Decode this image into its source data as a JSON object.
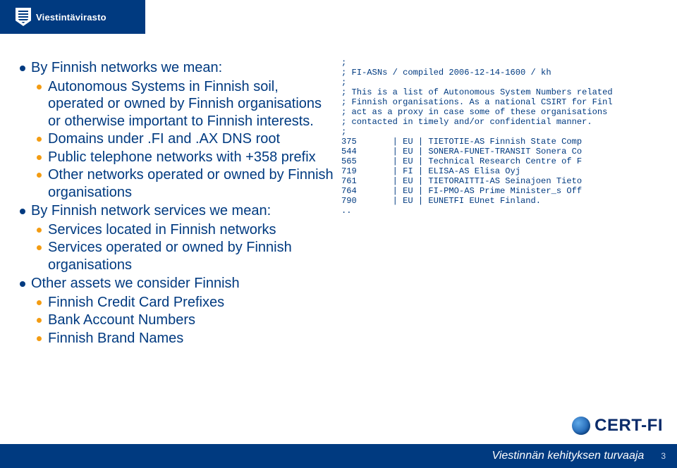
{
  "header": {
    "brand": "Viestintävirasto"
  },
  "left": {
    "l1": "By Finnish networks we mean:",
    "l1a": "Autonomous Systems in Finnish soil, operated or owned by Finnish organisations or otherwise important to Finnish interests.",
    "l1b": "Domains under .FI and .AX DNS root",
    "l1c": "Public telephone networks with +358 prefix",
    "l1d": "Other networks operated or owned by Finnish organisations",
    "l2": "By Finnish network services we mean:",
    "l2a": "Services located in Finnish networks",
    "l2b": "Services operated or owned by Finnish organisations",
    "l3": "Other assets we consider Finnish",
    "l3a": "Finnish Credit Card Prefixes",
    "l3b": "Bank Account Numbers",
    "l3c": "Finnish Brand Names"
  },
  "right": {
    "text": ";\n; FI-ASNs / compiled 2006-12-14-1600 / kh\n;\n; This is a list of Autonomous System Numbers related\n; Finnish organisations. As a national CSIRT for Finl\n; act as a proxy in case some of these organisations \n; contacted in timely and/or confidential manner.\n;\n375       | EU | TIETOTIE-AS Finnish State Comp\n544       | EU | SONERA-FUNET-TRANSIT Sonera Co\n565       | EU | Technical Research Centre of F\n719       | FI | ELISA-AS Elisa Oyj\n761       | EU | TIETORAITTI-AS Seinajoen Tieto\n764       | EU | FI-PMO-AS Prime Minister_s Off\n790       | EU | EUNETFI EUnet Finland.\n.."
  },
  "certfi": {
    "label": "CERT-FI"
  },
  "footer": {
    "tagline": "Viestinnän kehityksen turvaaja",
    "page": "3"
  }
}
